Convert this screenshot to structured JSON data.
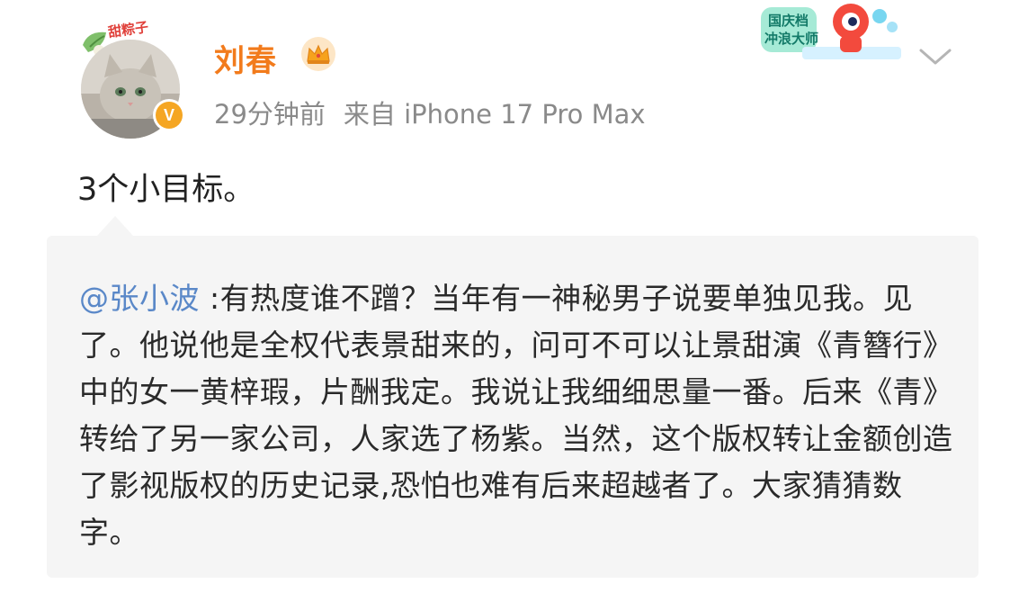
{
  "user": {
    "avatar_tag": "甜粽子",
    "name": "刘春",
    "verify_mark": "V"
  },
  "meta": {
    "time": "29分钟前",
    "source": "来自 iPhone 17 Pro Max"
  },
  "activity_badge": {
    "line1": "国庆档",
    "line2": "冲浪大师"
  },
  "post": {
    "text": "3个小目标。"
  },
  "repost": {
    "mention": "@张小波",
    "text": " :有热度谁不蹭？当年有一神秘男子说要单独见我。见了。他说他是全权代表景甜来的，问可不可以让景甜演《青簪行》中的女一黄梓瑕，片酬我定。我说让我细细思量一番。后来《青》转给了另一家公司，人家选了杨紫。当然，这个版权转让金额创造了影视版权的历史记录,恐怕也难有后来超越者了。大家猜猜数字。"
  },
  "colors": {
    "username": "#f27b1c",
    "mention": "#5a88c8",
    "verify": "#f5a623",
    "repost_bg": "#f5f5f5"
  },
  "icons": [
    "crown-icon",
    "verified-badge-icon",
    "chevron-down-icon",
    "avatar-cat-image",
    "activity-mascot-icon"
  ]
}
